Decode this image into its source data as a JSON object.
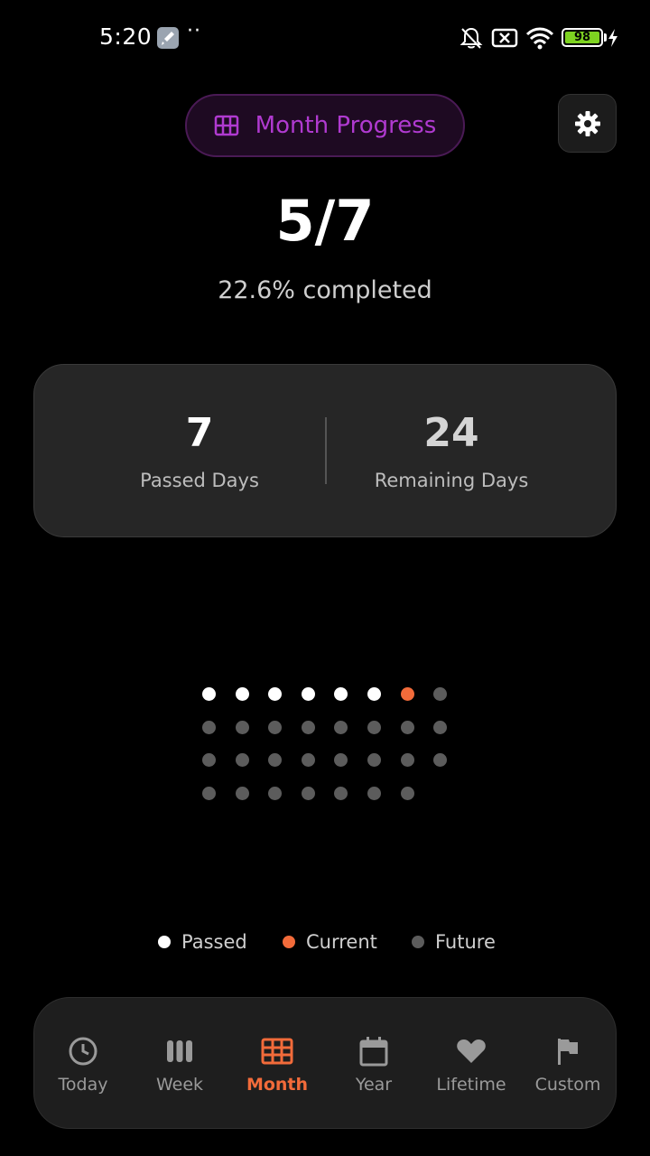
{
  "status_bar": {
    "time": "5:20",
    "battery_level": "98",
    "icons": [
      "wrench-badge-icon",
      "more-dots-icon",
      "bell-off-icon",
      "sim-off-icon",
      "wifi-icon",
      "battery-icon",
      "charging-bolt-icon"
    ]
  },
  "header": {
    "title": "Month Progress",
    "icon": "grid-calendar-icon",
    "settings_icon": "gear-icon",
    "accent_color": "#b03ad0"
  },
  "progress": {
    "fraction": "5/7",
    "percent_text": "22.6% completed"
  },
  "stats": {
    "passed_value": "7",
    "passed_label": "Passed Days",
    "remaining_value": "24",
    "remaining_label": "Remaining Days"
  },
  "days_grid": {
    "total": 31,
    "passed": 6,
    "current_index": 7,
    "colors": {
      "passed": "#ffffff",
      "current": "#f26b3a",
      "future": "#5c5c5c"
    }
  },
  "legend": {
    "passed": "Passed",
    "current": "Current",
    "future": "Future"
  },
  "nav": {
    "active": "Month",
    "active_color": "#f26b3a",
    "items": [
      {
        "label": "Today",
        "icon": "clock-icon"
      },
      {
        "label": "Week",
        "icon": "bars-icon"
      },
      {
        "label": "Month",
        "icon": "grid-icon"
      },
      {
        "label": "Year",
        "icon": "calendar-icon"
      },
      {
        "label": "Lifetime",
        "icon": "heart-icon"
      },
      {
        "label": "Custom",
        "icon": "flag-icon"
      }
    ]
  }
}
